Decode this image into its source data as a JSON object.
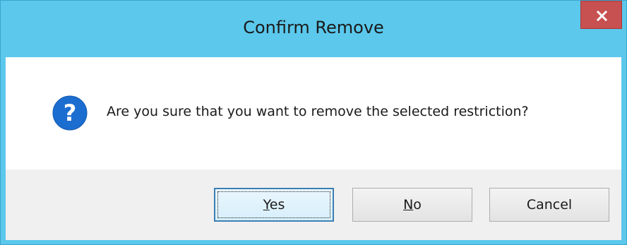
{
  "dialog": {
    "title": "Confirm Remove",
    "close_label": "x",
    "message": "Are you sure that you want to remove the selected restriction?",
    "icon": "question-icon",
    "buttons": {
      "yes": {
        "mnemonic": "Y",
        "rest": "es"
      },
      "no": {
        "mnemonic": "N",
        "rest": "o"
      },
      "cancel": {
        "label": "Cancel"
      }
    }
  },
  "colors": {
    "title_bar": "#5bc8ec",
    "close_button": "#c75050",
    "icon_blue": "#1c6dd0",
    "default_button_border": "#3c7fb1"
  }
}
